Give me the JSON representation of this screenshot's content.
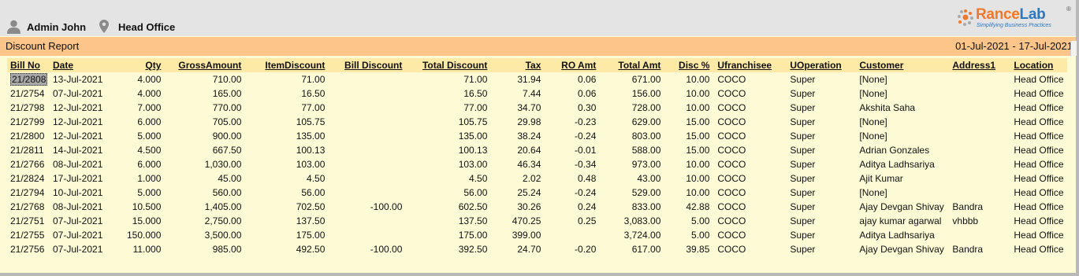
{
  "header": {
    "user_name": "Admin John",
    "branch_name": "Head Office",
    "logo_word_1": "Rance",
    "logo_word_2": "Lab",
    "logo_tagline": "Simplifying Business Practices",
    "logo_reg": "®"
  },
  "report": {
    "title": "Discount Report",
    "date_range": "01-Jul-2021 - 17-Jul-2021"
  },
  "colors": {
    "header_bg": "#e4e4e4",
    "report_bar": "#fdc58a",
    "grid_bg": "#fdfbd6",
    "column_header_bg": "#fdeaa7",
    "logo_orange": "#f0792a",
    "logo_blue": "#2a78c0"
  },
  "icons": {
    "user": "user-icon",
    "branch": "map-pin-icon",
    "logo": "gear-logo-icon"
  },
  "table": {
    "columns": [
      "Bill No",
      "Date",
      "Qty",
      "GrossAmount",
      "ItemDiscount",
      "Bill Discount",
      "Total Discount",
      "Tax",
      "RO Amt",
      "Total Amt",
      "Disc %",
      "Ufranchisee",
      "UOperation",
      "Customer",
      "Address1",
      "Location"
    ],
    "rows": [
      [
        "21/2808",
        "13-Jul-2021",
        "4.000",
        "710.00",
        "71.00",
        "",
        "71.00",
        "31.94",
        "0.06",
        "671.00",
        "10.00",
        "COCO",
        "Super",
        "[None]",
        "",
        "Head Office"
      ],
      [
        "21/2754",
        "07-Jul-2021",
        "4.000",
        "165.00",
        "16.50",
        "",
        "16.50",
        "7.44",
        "0.06",
        "156.00",
        "10.00",
        "COCO",
        "Super",
        "[None]",
        "",
        "Head Office"
      ],
      [
        "21/2798",
        "12-Jul-2021",
        "7.000",
        "770.00",
        "77.00",
        "",
        "77.00",
        "34.70",
        "0.30",
        "728.00",
        "10.00",
        "COCO",
        "Super",
        "Akshita Saha",
        "",
        "Head Office"
      ],
      [
        "21/2799",
        "12-Jul-2021",
        "6.000",
        "705.00",
        "105.75",
        "",
        "105.75",
        "29.98",
        "-0.23",
        "629.00",
        "15.00",
        "COCO",
        "Super",
        "[None]",
        "",
        "Head Office"
      ],
      [
        "21/2800",
        "12-Jul-2021",
        "5.000",
        "900.00",
        "135.00",
        "",
        "135.00",
        "38.24",
        "-0.24",
        "803.00",
        "15.00",
        "COCO",
        "Super",
        "[None]",
        "",
        "Head Office"
      ],
      [
        "21/2811",
        "14-Jul-2021",
        "4.500",
        "667.50",
        "100.13",
        "",
        "100.13",
        "20.64",
        "-0.01",
        "588.00",
        "15.00",
        "COCO",
        "Super",
        "Adrian Gonzales",
        "",
        "Head Office"
      ],
      [
        "21/2766",
        "08-Jul-2021",
        "6.000",
        "1,030.00",
        "103.00",
        "",
        "103.00",
        "46.34",
        "-0.34",
        "973.00",
        "10.00",
        "COCO",
        "Super",
        "Aditya Ladhsariya",
        "",
        "Head Office"
      ],
      [
        "21/2824",
        "17-Jul-2021",
        "1.000",
        "45.00",
        "4.50",
        "",
        "4.50",
        "2.02",
        "0.48",
        "43.00",
        "10.00",
        "COCO",
        "Super",
        "Ajit Kumar",
        "",
        "Head Office"
      ],
      [
        "21/2794",
        "10-Jul-2021",
        "5.000",
        "560.00",
        "56.00",
        "",
        "56.00",
        "25.24",
        "-0.24",
        "529.00",
        "10.00",
        "COCO",
        "Super",
        "[None]",
        "",
        "Head Office"
      ],
      [
        "21/2768",
        "08-Jul-2021",
        "10.500",
        "1,405.00",
        "702.50",
        "-100.00",
        "602.50",
        "30.26",
        "0.24",
        "833.00",
        "42.88",
        "COCO",
        "Super",
        "Ajay Devgan Shivay",
        "Bandra",
        "Head Office"
      ],
      [
        "21/2751",
        "07-Jul-2021",
        "15.000",
        "2,750.00",
        "137.50",
        "",
        "137.50",
        "470.25",
        "0.25",
        "3,083.00",
        "5.00",
        "COCO",
        "Super",
        "ajay kumar agarwal",
        "vhbbb",
        "Head Office"
      ],
      [
        "21/2755",
        "07-Jul-2021",
        "150.000",
        "3,500.00",
        "175.00",
        "",
        "175.00",
        "399.00",
        "",
        "3,724.00",
        "5.00",
        "COCO",
        "Super",
        "Aditya Ladhsariya",
        "",
        "Head Office"
      ],
      [
        "21/2756",
        "07-Jul-2021",
        "11.000",
        "985.00",
        "492.50",
        "-100.00",
        "392.50",
        "24.70",
        "-0.20",
        "617.00",
        "39.85",
        "COCO",
        "Super",
        "Ajay Devgan Shivay",
        "Bandra",
        "Head Office"
      ]
    ]
  }
}
